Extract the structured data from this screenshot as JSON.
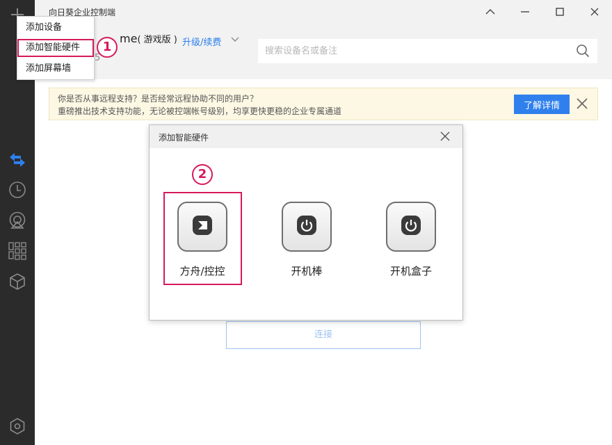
{
  "app": {
    "title": "向日葵企业控制端"
  },
  "user": {
    "name_suffix": "me",
    "edition": "( 游戏版 )",
    "upgrade_link": "升级/续费",
    "sub_digit": "5"
  },
  "search": {
    "placeholder": "搜索设备名或备注"
  },
  "add_menu": {
    "items": [
      {
        "label": "添加设备"
      },
      {
        "label": "添加智能硬件"
      },
      {
        "label": "添加屏幕墙"
      }
    ]
  },
  "steps": {
    "one": "1",
    "two": "2"
  },
  "banner": {
    "line1": "你是否从事远程支持？是否经常远程协助不同的用户？",
    "line2": "重磅推出技术支持功能，无论被控端帐号级别，均享更快更稳的企业专属通道",
    "button": "了解详情"
  },
  "main": {
    "connect_label": "连接"
  },
  "modal": {
    "title": "添加智能硬件",
    "items": [
      {
        "label": "方舟/控控"
      },
      {
        "label": "开机棒"
      },
      {
        "label": "开机盒子"
      }
    ]
  },
  "colors": {
    "accent": "#2f80ed",
    "highlight": "#d6195c",
    "sidebar": "#2b2b2b",
    "active_icon": "#2f80ed"
  },
  "sidebar": {
    "icons": [
      "remote-control-icon",
      "history-icon",
      "screen-wall-icon",
      "apps-icon",
      "cube-icon",
      "settings-hex-icon"
    ]
  }
}
